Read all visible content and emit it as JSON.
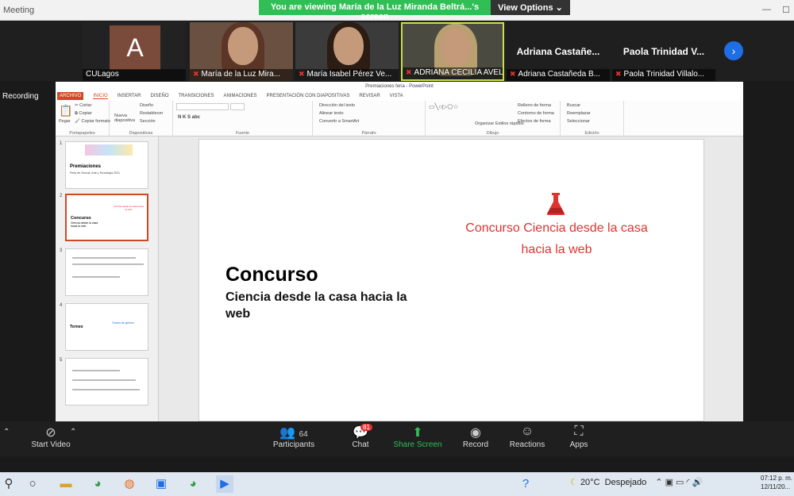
{
  "window": {
    "title": "Meeting"
  },
  "banner": {
    "text": "You are viewing María de la Luz Miranda Beltrá...'s screen",
    "options": "View Options"
  },
  "participants": [
    {
      "name": "CULagos",
      "initial": "A"
    },
    {
      "name": "María de la Luz Mira..."
    },
    {
      "name": "María Isabel Pérez Ve..."
    },
    {
      "name": "ADRIANA CECILIA AVELA..."
    },
    {
      "name": "Adriana Castañeda B...",
      "big": "Adriana Castañe..."
    },
    {
      "name": "Paola Trinidad Villalo...",
      "big": "Paola Trinidad V..."
    }
  ],
  "recording": "Recording",
  "ppt": {
    "title": "Premiaciones feria - PowerPoint",
    "tabs": [
      "ARCHIVO",
      "INICIO",
      "INSERTAR",
      "DISEÑO",
      "TRANSICIONES",
      "ANIMACIONES",
      "PRESENTACIÓN CON DIAPOSITIVAS",
      "REVISAR",
      "VISTA"
    ],
    "ribbon": {
      "portapapeles": {
        "label": "Portapapeles",
        "paste": "Pegar",
        "cut": "Cortar",
        "copy": "Copiar",
        "format": "Copiar formato"
      },
      "diapositivas": {
        "label": "Diapositivas",
        "new": "Nueva diapositiva",
        "layout": "Diseño",
        "reset": "Restablecer",
        "section": "Sección"
      },
      "fuente": {
        "label": "Fuente"
      },
      "parrafo": {
        "label": "Párrafo",
        "dir": "Dirección del texto",
        "align": "Alinear texto",
        "smart": "Convertir a SmartArt"
      },
      "dibujo": {
        "label": "Dibujo",
        "organize": "Organizar",
        "quick": "Estilos rápidos",
        "fill": "Relleno de forma",
        "outline": "Contorno de forma",
        "effects": "Efectos de forma"
      },
      "edicion": {
        "label": "Edición",
        "find": "Buscar",
        "replace": "Reemplazar",
        "select": "Seleccionar"
      }
    },
    "thumbs": [
      {
        "n": "1",
        "title": "Premiaciones",
        "sub": "Feria de Ciencia, Arte y Tecnología 2021"
      },
      {
        "n": "2",
        "title": "Concurso",
        "sub": "Ciencia desde la casa hacia la web"
      },
      {
        "n": "3"
      },
      {
        "n": "4",
        "title": "Torneo",
        "sub": "Torneo de ajedrez"
      },
      {
        "n": "5"
      }
    ],
    "slide": {
      "heading": "Concurso",
      "subheading": "Ciencia desde la casa hacia la web",
      "red_line1": "Concurso Ciencia desde la casa",
      "red_line2": "hacia la web"
    }
  },
  "toolbar": {
    "start_video": "Start Video",
    "participants": "Participants",
    "participants_count": "64",
    "chat": "Chat",
    "chat_badge": "81",
    "share": "Share Screen",
    "record": "Record",
    "reactions": "Reactions",
    "apps": "Apps"
  },
  "taskbar": {
    "temp": "20°C",
    "weather": "Despejado",
    "time": "07:12 p. m.",
    "date": "12/11/20..."
  },
  "colors": {
    "accent": "#d24726",
    "share": "#2fbf55",
    "red": "#e0332f"
  }
}
